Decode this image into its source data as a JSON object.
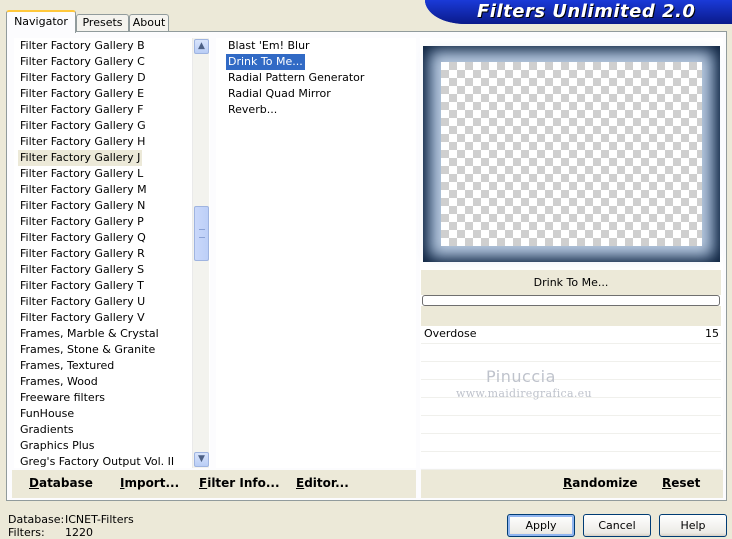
{
  "tabs": [
    {
      "label": "Navigator",
      "active": true
    },
    {
      "label": "Presets",
      "active": false
    },
    {
      "label": "About",
      "active": false
    }
  ],
  "banner": {
    "title": "Filters Unlimited 2.0"
  },
  "categories": [
    "Filter Factory Gallery B",
    "Filter Factory Gallery C",
    "Filter Factory Gallery D",
    "Filter Factory Gallery E",
    "Filter Factory Gallery F",
    "Filter Factory Gallery G",
    "Filter Factory Gallery H",
    "Filter Factory Gallery J",
    "Filter Factory Gallery L",
    "Filter Factory Gallery M",
    "Filter Factory Gallery N",
    "Filter Factory Gallery P",
    "Filter Factory Gallery Q",
    "Filter Factory Gallery R",
    "Filter Factory Gallery S",
    "Filter Factory Gallery T",
    "Filter Factory Gallery U",
    "Filter Factory Gallery V",
    "Frames, Marble & Crystal",
    "Frames, Stone & Granite",
    "Frames, Textured",
    "Frames, Wood",
    "Freeware filters",
    "FunHouse",
    "Gradients",
    "Graphics Plus",
    "Greg's Factory Output Vol. II"
  ],
  "selected_category": "Filter Factory Gallery J",
  "filters": [
    "Blast 'Em! Blur",
    "Drink To Me...",
    "Radial Pattern Generator",
    "Radial Quad Mirror",
    "Reverb..."
  ],
  "selected_filter": "Drink To Me...",
  "filter_name_display": "Drink To Me...",
  "progress_percent": 0,
  "parameters": [
    {
      "name": "Overdose",
      "value": "15"
    }
  ],
  "watermark": {
    "line1": "Pinuccia",
    "line2": "www.maidiregrafica.eu"
  },
  "actions_left": [
    "Database",
    "Import...",
    "Filter Info...",
    "Editor..."
  ],
  "actions_right": [
    "Randomize",
    "Reset"
  ],
  "status": {
    "database_label": "Database:",
    "database_value": "ICNET-Filters",
    "filters_label": "Filters:",
    "filters_value": "1220"
  },
  "buttons": {
    "apply": "Apply",
    "cancel": "Cancel",
    "help": "Help"
  },
  "icons": {
    "scroll_up": "chevron-up-icon",
    "scroll_down": "chevron-down-icon"
  },
  "colors": {
    "selection": "#316ac5",
    "banner": "#0b1f9e",
    "tab_highlight": "#ffc83c"
  }
}
